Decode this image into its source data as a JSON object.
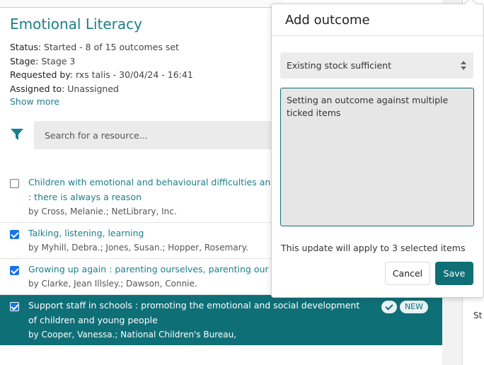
{
  "page": {
    "title": "Emotional Literacy",
    "meta": [
      {
        "label": "Status:",
        "value": "Started - 8 of 15 outcomes set"
      },
      {
        "label": "Stage:",
        "value": "Stage 3"
      },
      {
        "label": "Requested by:",
        "value": "rxs talis - 30/04/24 - 16:41"
      },
      {
        "label": "Assigned to:",
        "value": "Unassigned"
      }
    ],
    "show_more": "Show more",
    "search_placeholder": "Search for a resource..."
  },
  "items": [
    {
      "title": "Children with emotional and behavioural difficulties and",
      "title2": ": there is always a reason",
      "by": "by Cross, Melanie.; NetLibrary, Inc.",
      "checked": false
    },
    {
      "title": "Talking, listening, learning",
      "by": "by Myhill, Debra.; Jones, Susan.; Hopper, Rosemary.",
      "checked": true
    },
    {
      "title": "Growing up again : parenting ourselves, parenting our ch",
      "by": "by Clarke, Jean Illsley.; Dawson, Connie.",
      "checked": true
    },
    {
      "title": "Support staff in schools : promoting the emotional and social development of children and young people",
      "by": "by Cooper, Vanessa.; National Children's Bureau,",
      "checked": true,
      "badge": "NEW"
    }
  ],
  "right_fragments": [
    "St"
  ],
  "popover": {
    "title": "Add outcome",
    "select_value": "Existing stock sufficient",
    "textarea_value": "Setting an outcome against multiple ticked items",
    "note": "This update will apply to 3 selected items",
    "cancel_label": "Cancel",
    "save_label": "Save"
  },
  "colors": {
    "accent": "#1d7e8c",
    "selected_row": "#0f6f77",
    "checkbox": "#1a73e8"
  }
}
